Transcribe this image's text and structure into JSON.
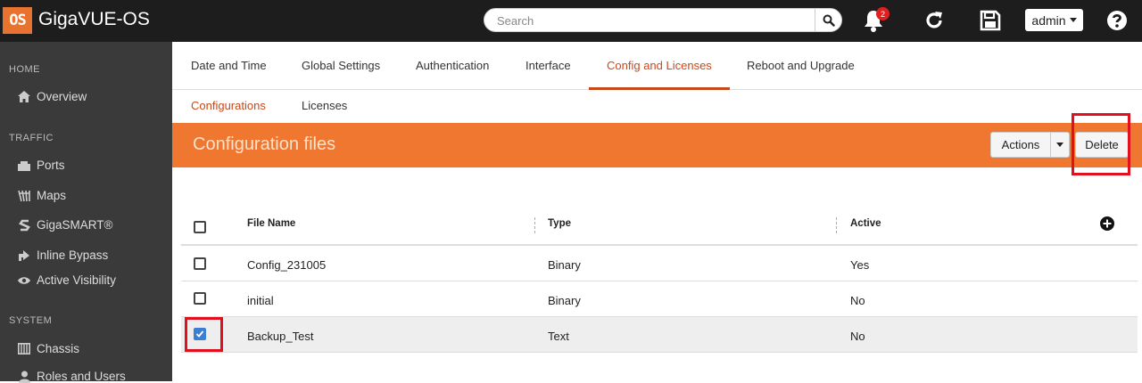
{
  "app": {
    "logo_text": "OS",
    "name": "GigaVUE-OS"
  },
  "search": {
    "placeholder": "Search"
  },
  "notifications": {
    "count": "2"
  },
  "user": {
    "name": "admin"
  },
  "sidebar": {
    "sections": [
      {
        "title": "HOME",
        "items": [
          {
            "label": "Overview",
            "icon": "home-icon"
          }
        ]
      },
      {
        "title": "TRAFFIC",
        "items": [
          {
            "label": "Ports",
            "icon": "ports-icon"
          },
          {
            "label": "Maps",
            "icon": "maps-icon"
          },
          {
            "label": "GigaSMART®",
            "icon": "gigasmart-icon"
          },
          {
            "label": "Inline Bypass",
            "icon": "inline-bypass-icon"
          },
          {
            "label": "Active Visibility",
            "icon": "eye-icon"
          }
        ]
      },
      {
        "title": "SYSTEM",
        "items": [
          {
            "label": "Chassis",
            "icon": "chassis-icon"
          },
          {
            "label": "Roles and Users",
            "icon": "user-icon"
          }
        ]
      }
    ]
  },
  "tabs": [
    {
      "label": "Date and Time"
    },
    {
      "label": "Global Settings"
    },
    {
      "label": "Authentication"
    },
    {
      "label": "Interface"
    },
    {
      "label": "Config and Licenses",
      "active": true
    },
    {
      "label": "Reboot and Upgrade"
    }
  ],
  "subtabs": [
    {
      "label": "Configurations",
      "active": true
    },
    {
      "label": "Licenses"
    }
  ],
  "panel": {
    "title": "Configuration files",
    "actions_label": "Actions",
    "delete_label": "Delete"
  },
  "table": {
    "columns": [
      "File Name",
      "Type",
      "Active"
    ],
    "rows": [
      {
        "file_name": "Config_231005",
        "type": "Binary",
        "active": "Yes",
        "checked": false
      },
      {
        "file_name": "initial",
        "type": "Binary",
        "active": "No",
        "checked": false
      },
      {
        "file_name": "Backup_Test",
        "type": "Text",
        "active": "No",
        "checked": true
      }
    ]
  },
  "colors": {
    "accent": "#ef7730",
    "active_tab": "#c9481a",
    "highlight": "#e0101c",
    "checkbox": "#3b7fd4"
  }
}
